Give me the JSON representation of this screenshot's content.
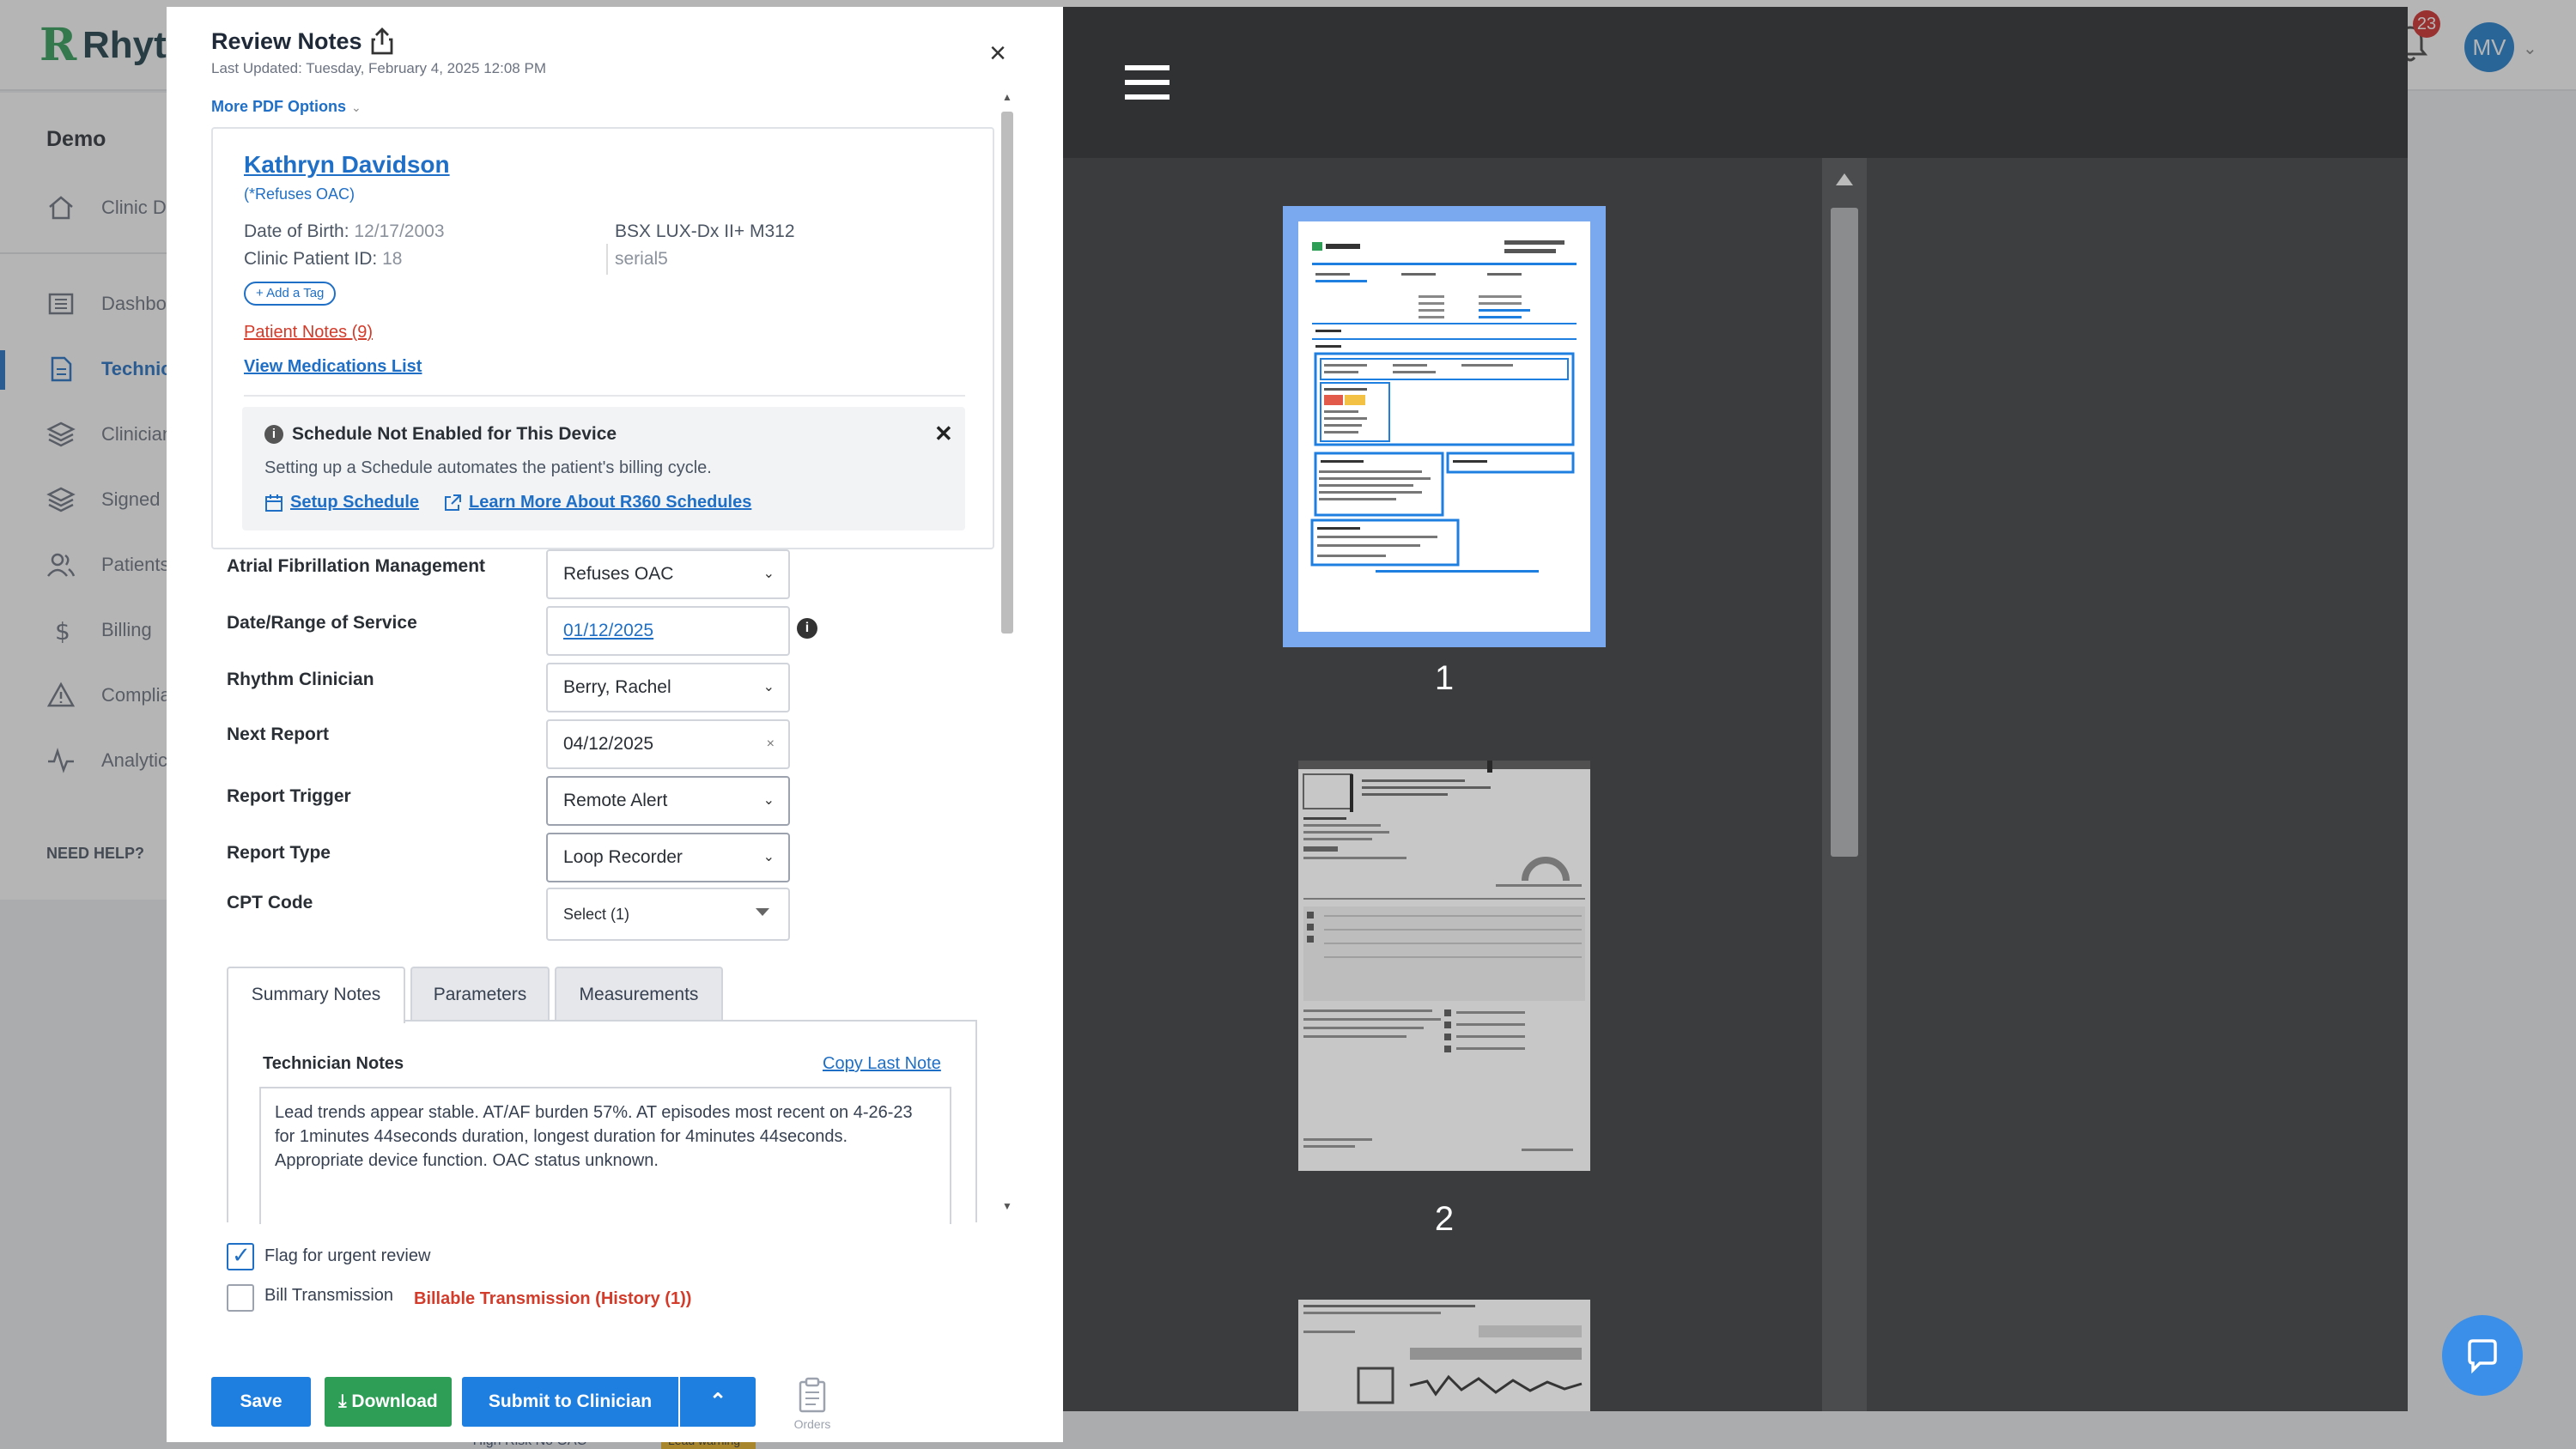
{
  "app": {
    "logo_text": "Rhyth",
    "notifications_count": "23",
    "user_initials": "MV"
  },
  "sidebar": {
    "title": "Demo",
    "items": [
      {
        "label": "Clinic Dashboard",
        "icon": "home-icon"
      },
      {
        "label": "Dashboard",
        "icon": "dashboard-icon"
      },
      {
        "label": "Technician",
        "icon": "document-icon"
      },
      {
        "label": "Clinician",
        "icon": "layers-icon"
      },
      {
        "label": "Signed",
        "icon": "layers-icon"
      },
      {
        "label": "Patients",
        "icon": "users-icon"
      },
      {
        "label": "Billing",
        "icon": "dollar-icon"
      },
      {
        "label": "Compliance",
        "icon": "warning-icon"
      },
      {
        "label": "Analytics",
        "icon": "activity-icon"
      }
    ],
    "need_help": "NEED HELP?"
  },
  "panel": {
    "title": "Review Notes",
    "last_updated": "Last Updated: Tuesday, February 4, 2025 12:08 PM",
    "more_pdf_options": "More PDF Options"
  },
  "patient": {
    "name": "Kathryn Davidson",
    "status": "(*Refuses OAC)",
    "dob_label": "Date of Birth:",
    "dob": "12/17/2003",
    "clinic_id_label": "Clinic Patient ID:",
    "clinic_id": "18",
    "device": "BSX LUX-Dx II+ M312",
    "serial": "serial5",
    "add_tag": "+ Add a Tag",
    "patient_notes": "Patient Notes (9)",
    "view_meds": "View Medications List"
  },
  "schedule": {
    "title": "Schedule Not Enabled for This Device",
    "text": "Setting up a Schedule automates the patient's billing cycle.",
    "setup_link": "Setup Schedule",
    "learn_link": "Learn More About R360 Schedules"
  },
  "form": {
    "afib_label": "Atrial Fibrillation Management",
    "afib_value": "Refuses OAC",
    "dos_label": "Date/Range of Service",
    "dos_value": "01/12/2025",
    "clinician_label": "Rhythm Clinician",
    "clinician_value": "Berry, Rachel",
    "next_report_label": "Next Report",
    "next_report_value": "04/12/2025",
    "trigger_label": "Report Trigger",
    "trigger_value": "Remote Alert",
    "type_label": "Report Type",
    "type_value": "Loop Recorder",
    "cpt_label": "CPT Code",
    "cpt_value": "Select (1)"
  },
  "tabs": [
    {
      "label": "Summary Notes",
      "active": true
    },
    {
      "label": "Parameters",
      "active": false
    },
    {
      "label": "Measurements",
      "active": false
    }
  ],
  "notes": {
    "label": "Technician Notes",
    "copy_last": "Copy Last Note",
    "text": "Lead trends appear stable. AT/AF burden 57%. AT episodes most recent on 4-26-23 for 1minutes 44seconds duration, longest duration for 4minutes 44seconds. Appropriate device function. OAC status unknown."
  },
  "flags": {
    "urgent_label": "Flag for urgent review",
    "urgent_checked": true,
    "bill_label": "Bill Transmission",
    "bill_checked": false,
    "billable_history": "Billable Transmission (History (1))"
  },
  "actions": {
    "save": "Save",
    "download": "Download",
    "submit": "Submit to Clinician",
    "orders": "Orders"
  },
  "viewer": {
    "pages": [
      "1",
      "2"
    ]
  },
  "background": {
    "peek_text": "* High Risk No OAC",
    "peek_badge": "Lead warning"
  },
  "colors": {
    "primary": "#1f7fe0",
    "success": "#2e9e57",
    "danger": "#d33b2a",
    "link": "#1f6fc6"
  }
}
